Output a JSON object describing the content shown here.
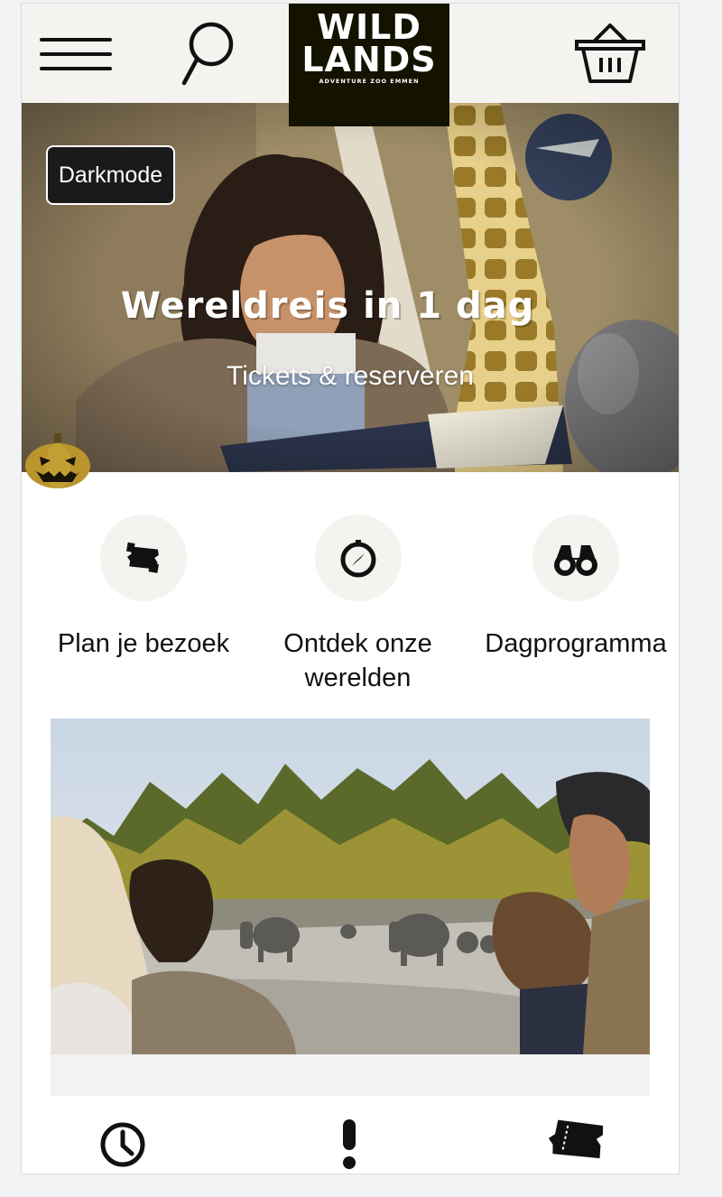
{
  "header": {
    "logo_line1": "WILD",
    "logo_line2": "LANDS",
    "logo_tagline": "ADVENTURE ZOO EMMEN",
    "menu_icon": "hamburger-menu-icon",
    "search_icon": "search-icon",
    "basket_icon": "shopping-basket-icon"
  },
  "hero": {
    "darkmode_label": "Darkmode",
    "title": "Wereldreis in 1 dag",
    "link_text": "Tickets & reserveren",
    "decoration_icon": "pumpkin-icon"
  },
  "quick_links": [
    {
      "label": "Plan je bezoek",
      "icon": "ticket-icon"
    },
    {
      "label": "Ontdek onze werelden",
      "icon": "compass-icon"
    },
    {
      "label": "Dagprogramma",
      "icon": "binoculars-icon"
    }
  ],
  "bottom_nav": [
    {
      "icon": "clock-icon"
    },
    {
      "icon": "exclamation-icon"
    },
    {
      "icon": "ticket-icon"
    }
  ],
  "colors": {
    "header_bg": "#f4f3ef",
    "logo_bg": "#141300",
    "darkmode_bg": "#1a1a1a",
    "icon_circle_bg": "#f4f3ef"
  }
}
